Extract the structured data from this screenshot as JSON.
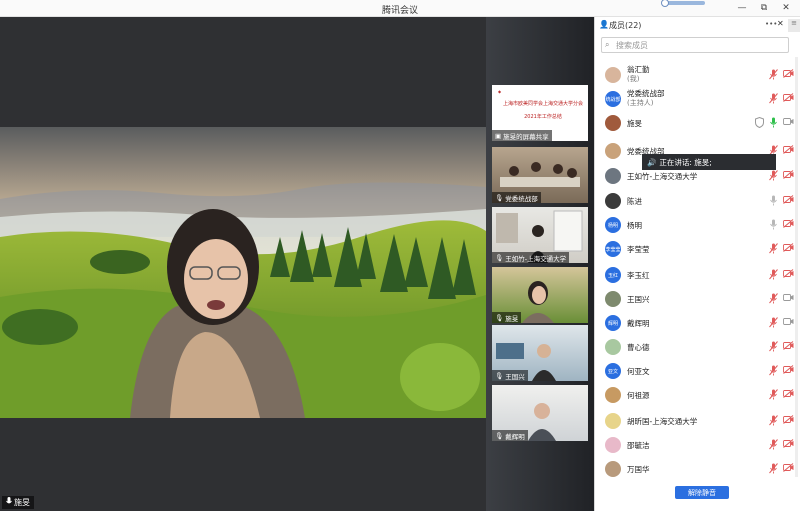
{
  "app": {
    "title": "腾讯会议"
  },
  "window": {
    "minimize": "—",
    "restore": "⧉",
    "close": "✕"
  },
  "main_video": {
    "speaker_label": "施旻"
  },
  "thumbnails": [
    {
      "label": "施旻的屏幕共享",
      "slide_title": "上海市欧美同学会上海交通大学分会",
      "slide_subtitle": "2021年工作总结"
    },
    {
      "label": "党委统战部"
    },
    {
      "label": "王如竹-上海交通大学"
    },
    {
      "label": "施旻"
    },
    {
      "label": "王国兴"
    },
    {
      "label": "戴辉明"
    }
  ],
  "panel": {
    "title": "成员(22)",
    "search_placeholder": "搜索成员",
    "more": "•••",
    "close": "✕",
    "unmute_all": "解除静音"
  },
  "members": [
    {
      "name": "翁汇勤",
      "role": "(我)",
      "avatar_type": "photo",
      "avatar_color": "#d8b59c",
      "mic": "muted",
      "cam": "off"
    },
    {
      "name": "党委统战部",
      "role": "(主持人)",
      "avatar_type": "text",
      "avatar_text": "统战部",
      "mic": "muted",
      "cam": "off"
    },
    {
      "name": "施旻",
      "role": "",
      "avatar_type": "photo",
      "avatar_color": "#a05a3c",
      "mic": "active",
      "cam": "on",
      "shield": true
    },
    {
      "name": "党委统战部",
      "role": "",
      "avatar_type": "photo",
      "avatar_color": "#c9a27a",
      "mic": "muted",
      "cam": "off"
    },
    {
      "name": "王如竹-上海交通大学",
      "role": "",
      "avatar_type": "photo",
      "avatar_color": "#6d7680",
      "mic": "muted",
      "cam": "off"
    },
    {
      "name": "陈进",
      "role": "",
      "avatar_type": "photo",
      "avatar_color": "#3b3b3b",
      "mic": "on",
      "cam": "off"
    },
    {
      "name": "杨明",
      "role": "",
      "avatar_type": "text",
      "avatar_text": "杨明",
      "mic": "on",
      "cam": "off"
    },
    {
      "name": "李莹莹",
      "role": "",
      "avatar_type": "text",
      "avatar_text": "李莹莹",
      "mic": "muted",
      "cam": "off"
    },
    {
      "name": "李玉红",
      "role": "",
      "avatar_type": "text",
      "avatar_text": "玉红",
      "mic": "muted",
      "cam": "off"
    },
    {
      "name": "王国兴",
      "role": "",
      "avatar_type": "photo",
      "avatar_color": "#7e8a6e",
      "mic": "muted",
      "cam": "on"
    },
    {
      "name": "戴辉明",
      "role": "",
      "avatar_type": "text",
      "avatar_text": "辉明",
      "mic": "muted",
      "cam": "on"
    },
    {
      "name": "曹心德",
      "role": "",
      "avatar_type": "photo",
      "avatar_color": "#a8c8a0",
      "mic": "muted",
      "cam": "off"
    },
    {
      "name": "何亚文",
      "role": "",
      "avatar_type": "text",
      "avatar_text": "亚文",
      "mic": "muted",
      "cam": "off"
    },
    {
      "name": "何祖源",
      "role": "",
      "avatar_type": "photo",
      "avatar_color": "#c79a62",
      "mic": "muted",
      "cam": "off"
    },
    {
      "name": "胡昕国-上海交通大学",
      "role": "",
      "avatar_type": "photo",
      "avatar_color": "#e7d48a",
      "mic": "muted",
      "cam": "off"
    },
    {
      "name": "邵毓洁",
      "role": "",
      "avatar_type": "photo",
      "avatar_color": "#e8b9c9",
      "mic": "muted",
      "cam": "off"
    },
    {
      "name": "万国华",
      "role": "",
      "avatar_type": "photo",
      "avatar_color": "#b89a7c",
      "mic": "muted",
      "cam": "off"
    }
  ],
  "tooltip": {
    "text": "正在讲话: 施旻;"
  },
  "colors": {
    "accent": "#2b6fe0",
    "muted": "#e05a5a",
    "active": "#2dbf4a"
  }
}
